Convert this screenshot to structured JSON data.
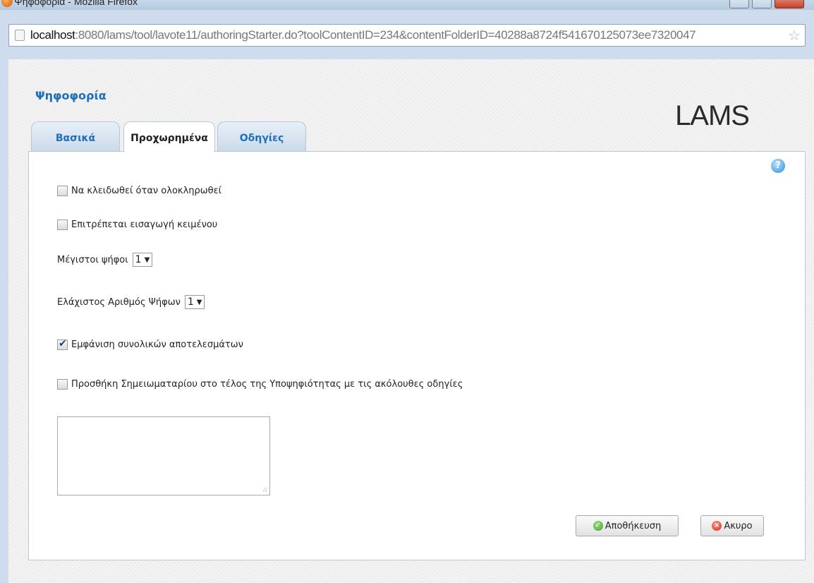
{
  "window": {
    "title": "Ψηφοφορία - Mozilla Firefox"
  },
  "browser": {
    "url_host": "localhost",
    "url_rest": ":8080/lams/tool/lavote11/authoringStarter.do?toolContentID=234&contentFolderID=40288a8724f541670125073ee7320047"
  },
  "page": {
    "title": "Ψηφοφορία",
    "logo": "LAMS",
    "help": "?",
    "tabs": [
      "Βασικά",
      "Προχωρημένα",
      "Οδηγίες"
    ],
    "active_tab": "Προχωρημένα"
  },
  "options": {
    "lock_on_finish": {
      "label": "Να κλειδωθεί όταν ολοκληρωθεί",
      "checked": false
    },
    "allow_text_entry": {
      "label": "Επιτρέπεται εισαγωγή κειμένου",
      "checked": false
    },
    "max_votes": {
      "label": "Μέγιστοι ψήφοι",
      "value": "1"
    },
    "min_votes": {
      "label": "Ελάχιστος Αριθμός Ψήφων",
      "value": "1"
    },
    "show_results": {
      "label": "Εμφάνιση συνολικών αποτελεσμάτων",
      "checked": true
    },
    "add_notebook": {
      "label": "Προσθήκη Σημειωματαρίου στο τέλος της Υποψηφιότητας με τις ακόλουθες οδηγίες",
      "checked": false
    },
    "notebook_instructions": ""
  },
  "buttons": {
    "save": "Αποθήκευση",
    "cancel": "Ακυρο"
  },
  "icons": {
    "url_page": "page-icon",
    "bookmark": "star-icon",
    "help": "help-icon",
    "save": "checkmark-icon",
    "cancel": "close-icon"
  }
}
